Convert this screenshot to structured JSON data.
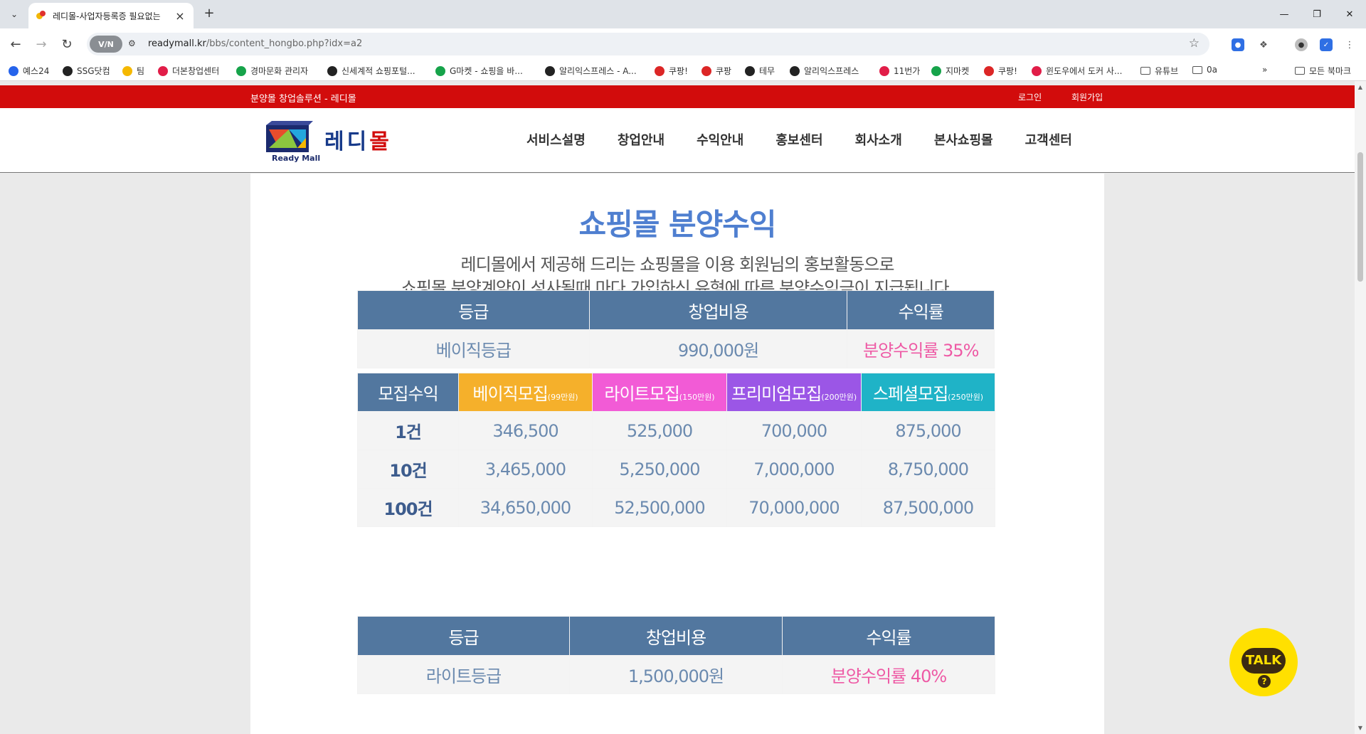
{
  "browser": {
    "tab_title": "레디몰-사업자등록증 필요없는",
    "url_domain": "readymall.kr",
    "url_path": "/bbs/content_hongbo.php?idx=a2",
    "vpn_label": "V/N",
    "bookmarks": [
      {
        "label": "예스24",
        "color": "#2563eb"
      },
      {
        "label": "SSG닷컴",
        "color": "#222222"
      },
      {
        "label": "팀",
        "color": "#f5b800"
      },
      {
        "label": "더본창업센터",
        "color": "#e11d48"
      },
      {
        "label": "경마문화 관리자",
        "color": "#16a34a"
      },
      {
        "label": "신세계적 쇼핑포털...",
        "color": "#222222"
      },
      {
        "label": "G마켓 - 쇼핑을 바...",
        "color": "#16a34a"
      },
      {
        "label": "알리익스프레스 - A...",
        "color": "#222222"
      },
      {
        "label": "쿠팡!",
        "color": "#dc2626"
      },
      {
        "label": "쿠팡",
        "color": "#dc2626"
      },
      {
        "label": "테무",
        "color": "#222222"
      },
      {
        "label": "알리익스프레스",
        "color": "#222222"
      },
      {
        "label": "11번가",
        "color": "#e11d48"
      },
      {
        "label": "지마켓",
        "color": "#16a34a"
      },
      {
        "label": "쿠팡!",
        "color": "#dc2626"
      },
      {
        "label": "윈도우에서 도커 사...",
        "color": "#e11d48"
      },
      {
        "label": "유튜브",
        "color": "folder"
      },
      {
        "label": "0a",
        "color": "folder"
      }
    ],
    "overflow_label": "»",
    "all_bookmarks_label": "모든 북마크"
  },
  "site": {
    "tagline": "분양몰 창업솔루션 - 레디몰",
    "login_label": "로그인",
    "join_label": "회원가입",
    "logo_ko": "레디몰",
    "logo_en": "Ready Mall",
    "nav": [
      "서비스설명",
      "창업안내",
      "수익안내",
      "홍보센터",
      "회사소개",
      "본사쇼핑몰",
      "고객센터"
    ]
  },
  "content": {
    "title": "쇼핑몰 분양수익",
    "desc_line1": "레디몰에서 제공해 드리는 쇼핑몰을 이용 회원님의 홍보활동으로",
    "desc_line2": "쇼핑몰 분양계약이 성사될때 마다 가입하신 유형에 따른 분양수익금이 지급됩니다.",
    "header_cols": [
      "등급",
      "창업비용",
      "수익률"
    ],
    "grade1": {
      "grade": "베이직등급",
      "cost": "990,000원",
      "rate": "분양수익률 35%"
    },
    "recruit_header": [
      {
        "label": "모집수익",
        "small": ""
      },
      {
        "label": "베이직모집",
        "small": "(99만원)"
      },
      {
        "label": "라이트모집",
        "small": "(150만원)"
      },
      {
        "label": "프리미엄모집",
        "small": "(200만원)"
      },
      {
        "label": "스페셜모집",
        "small": "(250만원)"
      }
    ],
    "recruit_rows": [
      {
        "count": "1건",
        "values": [
          "346,500",
          "525,000",
          "700,000",
          "875,000"
        ]
      },
      {
        "count": "10건",
        "values": [
          "3,465,000",
          "5,250,000",
          "7,000,000",
          "8,750,000"
        ]
      },
      {
        "count": "100건",
        "values": [
          "34,650,000",
          "52,500,000",
          "70,000,000",
          "87,500,000"
        ]
      }
    ],
    "grade2": {
      "grade": "라이트등급",
      "cost": "1,500,000원",
      "rate": "분양수익률 40%"
    }
  },
  "widget": {
    "talk_label": "TALK",
    "talk_help": "?"
  },
  "colors": {
    "topbar": "#d20c0c",
    "table_header": "#52779f",
    "basic": "#f5b02b",
    "light": "#f25bd6",
    "premium": "#9b56e6",
    "special": "#1fb3c7",
    "title": "#4f7fd0",
    "rate_pink": "#ee5aa5",
    "kakao": "#ffe000"
  }
}
